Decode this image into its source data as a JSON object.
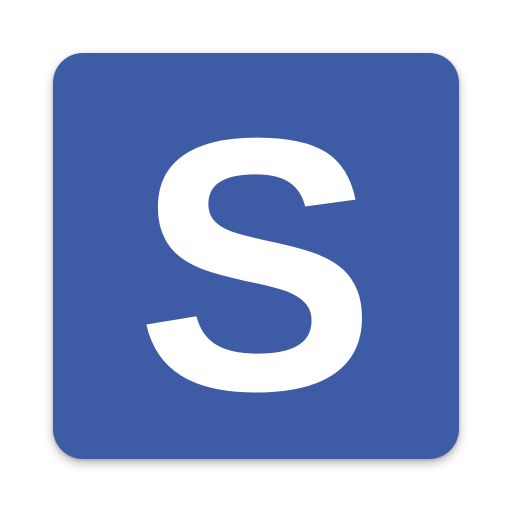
{
  "icon": {
    "name": "s-letter-app-icon",
    "letter": "S",
    "background_color": "#3e5ca6",
    "letter_color": "#ffffff"
  }
}
